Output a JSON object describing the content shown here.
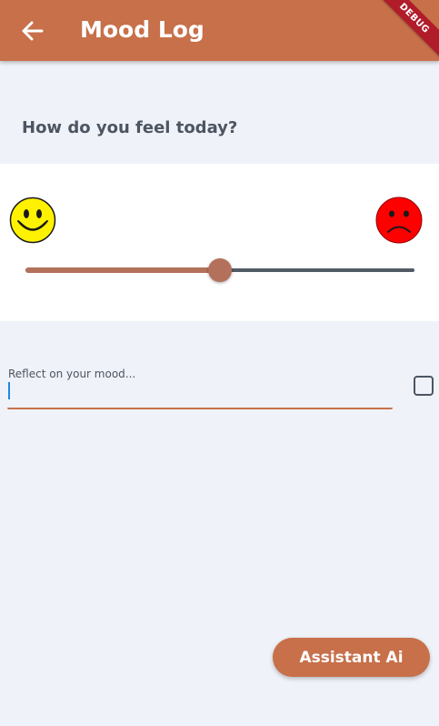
{
  "appbar": {
    "title": "Mood Log",
    "back_icon": "arrow-left-icon",
    "debug_label": "DEBUG",
    "color": "#C7704A"
  },
  "question": "How do you feel today?",
  "mood_slider": {
    "start_icon": "happy-face-icon",
    "end_icon": "sad-face-icon",
    "value_fraction": 0.5,
    "active_color": "#B3705A",
    "inactive_color": "#525C66"
  },
  "reflection": {
    "placeholder": "Reflect on your mood...",
    "value": ""
  },
  "checkbox": {
    "checked": false,
    "icon": "checkbox-empty-icon"
  },
  "assistant_button": {
    "label": "Assistant Ai",
    "color": "#C7704A"
  }
}
